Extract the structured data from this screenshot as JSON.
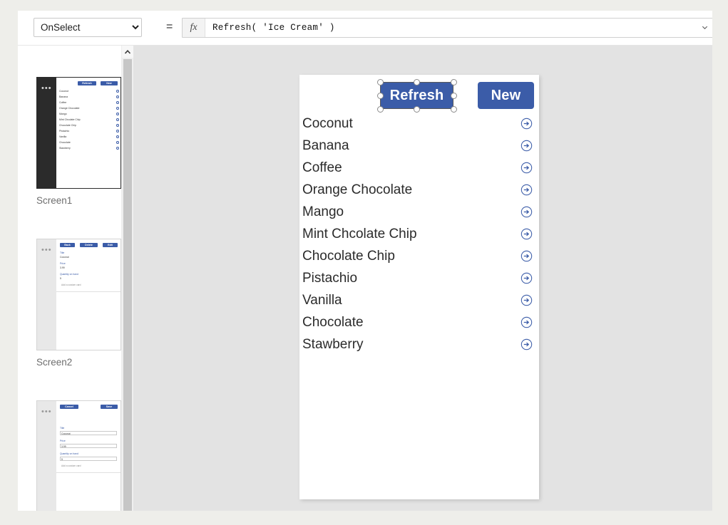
{
  "formula_bar": {
    "property_selected": "OnSelect",
    "property_options": [
      "OnSelect"
    ],
    "equals": "=",
    "fx_label": "fx",
    "formula": "Refresh( 'Ice Cream' )",
    "dropdown_icon": "chevron-down-icon"
  },
  "screens": [
    {
      "label": "Screen1",
      "selected": true,
      "menu_icon": "more-options-icon",
      "preview": {
        "type": "gallery",
        "buttons": [
          "Refresh",
          "New"
        ],
        "items": [
          "Coconut",
          "Banana",
          "Coffee",
          "Orange Chocolate",
          "Mango",
          "Mint Chcolate Chip",
          "Chocolate Chip",
          "Pistachio",
          "Vanilla",
          "Chocolate",
          "Stawberry"
        ]
      }
    },
    {
      "label": "Screen2",
      "selected": false,
      "menu_icon": "more-options-icon",
      "preview": {
        "type": "detail-form",
        "buttons": [
          "Back",
          "Delete",
          "Edit"
        ],
        "fields": [
          {
            "label": "Title",
            "value": "Coconut"
          },
          {
            "label": "Price",
            "value": "3.99"
          },
          {
            "label": "Quantity on hand",
            "value": "5"
          }
        ],
        "add_card": "Add a custom card"
      }
    },
    {
      "label": "",
      "selected": false,
      "menu_icon": "more-options-icon",
      "preview": {
        "type": "edit-form",
        "buttons": [
          "Cancel",
          "Save"
        ],
        "fields": [
          {
            "label": "Title",
            "value": "Coconut"
          },
          {
            "label": "Price",
            "value": "3.99"
          },
          {
            "label": "Quantity on hand",
            "value": "5"
          }
        ],
        "add_card": "Add a custom card"
      }
    }
  ],
  "canvas": {
    "buttons": {
      "refresh": "Refresh",
      "new": "New"
    },
    "selected_control": "Refresh",
    "gallery_items": [
      {
        "label": "Coconut",
        "icon": "arrow-right-circle-icon"
      },
      {
        "label": "Banana",
        "icon": "arrow-right-circle-icon"
      },
      {
        "label": "Coffee",
        "icon": "arrow-right-circle-icon"
      },
      {
        "label": "Orange Chocolate",
        "icon": "arrow-right-circle-icon"
      },
      {
        "label": "Mango",
        "icon": "arrow-right-circle-icon"
      },
      {
        "label": "Mint Chcolate Chip",
        "icon": "arrow-right-circle-icon"
      },
      {
        "label": "Chocolate Chip",
        "icon": "arrow-right-circle-icon"
      },
      {
        "label": "Pistachio",
        "icon": "arrow-right-circle-icon"
      },
      {
        "label": "Vanilla",
        "icon": "arrow-right-circle-icon"
      },
      {
        "label": "Chocolate",
        "icon": "arrow-right-circle-icon"
      },
      {
        "label": "Stawberry",
        "icon": "arrow-right-circle-icon"
      }
    ]
  },
  "scrollbar": {
    "up_arrow_icon": "chevron-up-icon"
  },
  "colors": {
    "accent_blue": "#3b5ca8",
    "canvas_bg": "#e3e3e3",
    "selected_thumb_strip": "#2b2b2b",
    "page_bg": "#eeeeea"
  }
}
